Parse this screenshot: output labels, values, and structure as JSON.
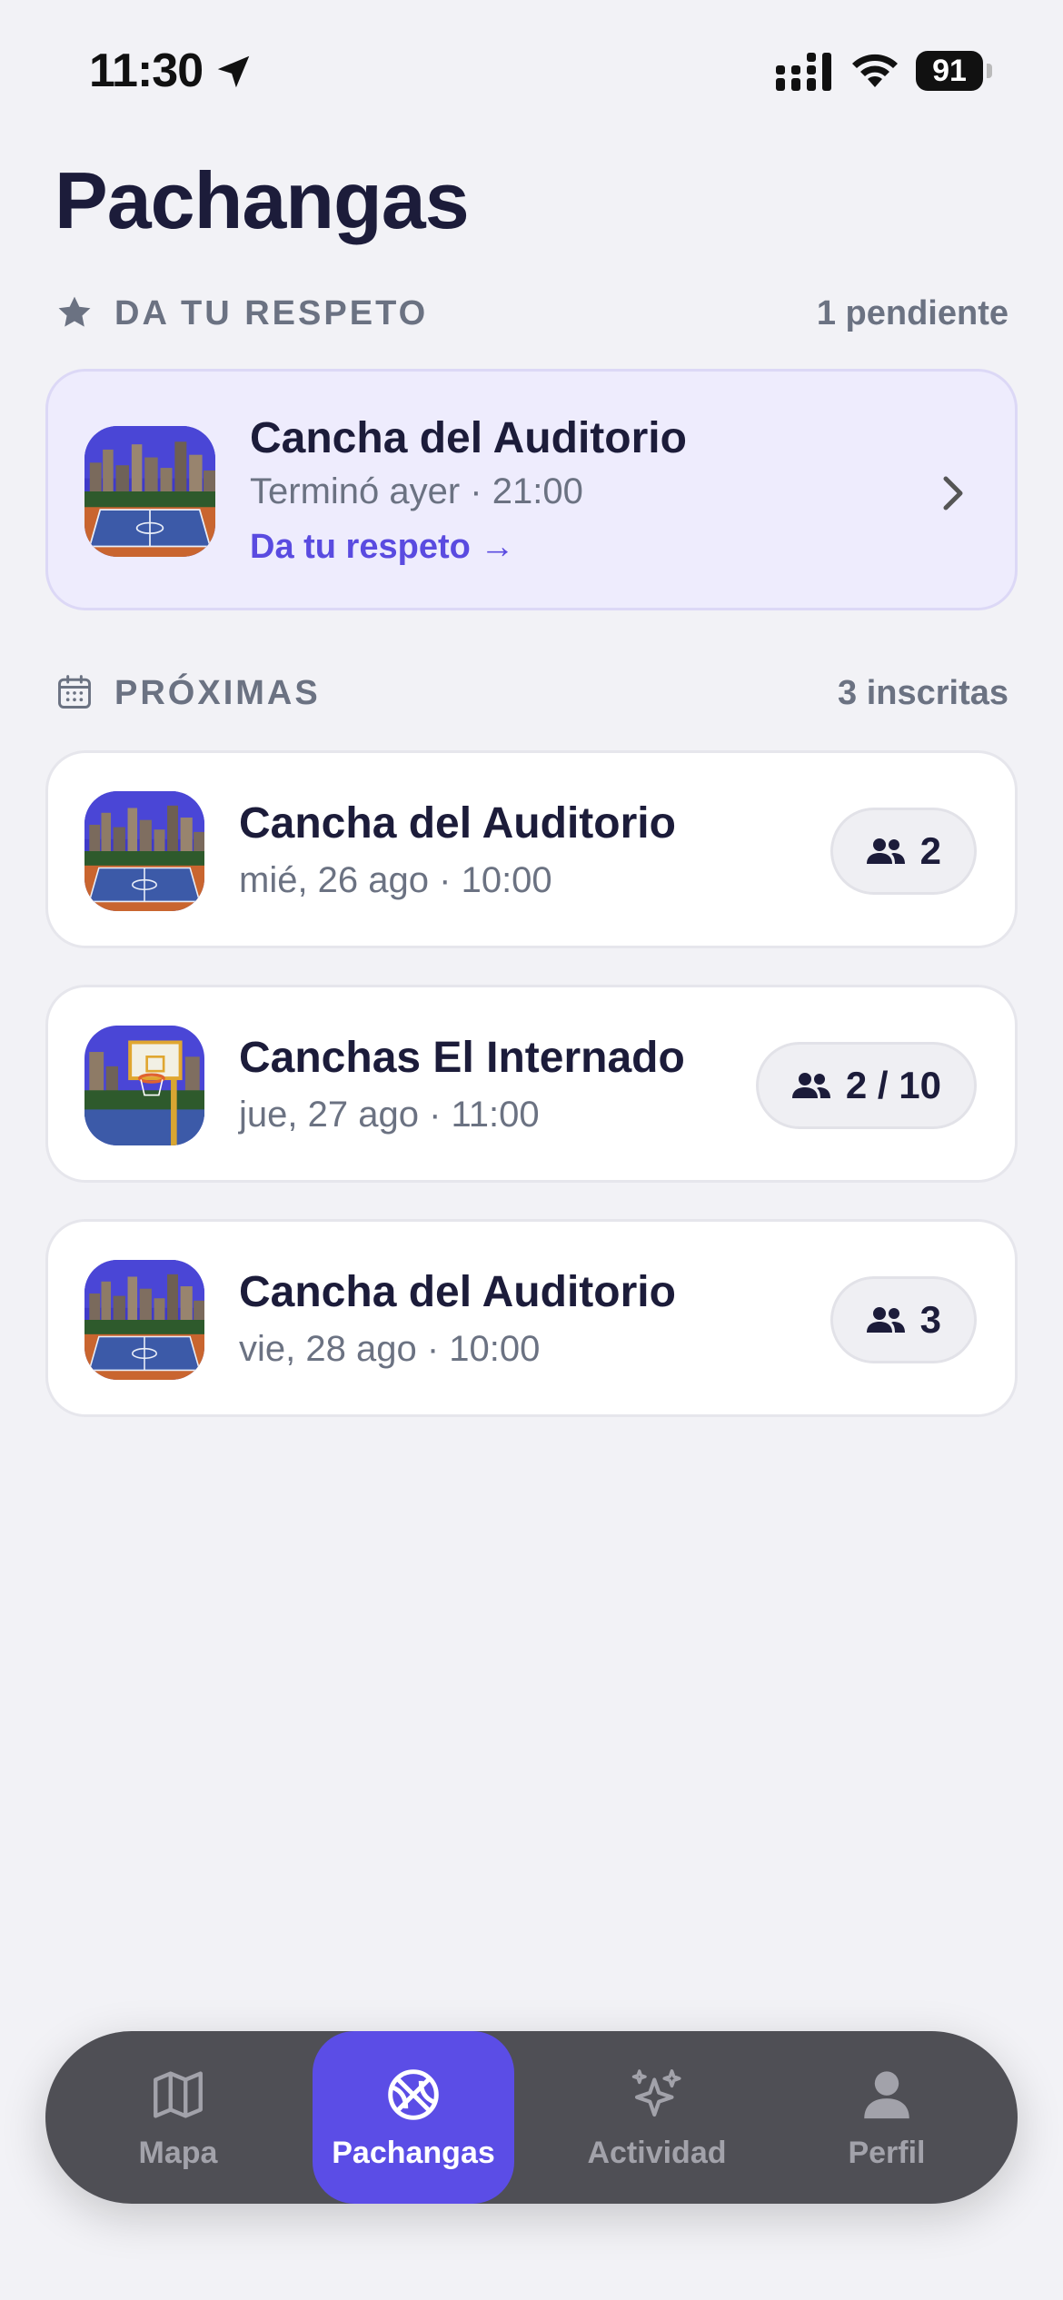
{
  "status_bar": {
    "time": "11:30",
    "battery": "91"
  },
  "page": {
    "title": "Pachangas"
  },
  "rate_section": {
    "label": "DA TU RESPETO",
    "meta": "1 pendiente",
    "icon": "star-icon",
    "card": {
      "title": "Cancha del Auditorio",
      "subtitle": "Terminó ayer · 21:00",
      "action": "Da tu respeto →"
    }
  },
  "upcoming_section": {
    "label": "PRÓXIMAS",
    "meta": "3 inscritas",
    "icon": "calendar-icon",
    "items": [
      {
        "title": "Cancha del Auditorio",
        "subtitle": "mié, 26 ago · 10:00",
        "count": "2"
      },
      {
        "title": "Canchas El Internado",
        "subtitle": "jue, 27 ago · 11:00",
        "count": "2 / 10"
      },
      {
        "title": "Cancha del Auditorio",
        "subtitle": "vie, 28 ago · 10:00",
        "count": "3"
      }
    ]
  },
  "tab_bar": {
    "tabs": [
      {
        "label": "Mapa",
        "icon": "map-icon"
      },
      {
        "label": "Pachangas",
        "icon": "basketball-icon",
        "active": true
      },
      {
        "label": "Actividad",
        "icon": "sparkles-icon"
      },
      {
        "label": "Perfil",
        "icon": "person-icon"
      }
    ]
  },
  "colors": {
    "accent": "#5b4de6",
    "background": "#f2f2f6",
    "pending_card": "#eeecfd"
  }
}
